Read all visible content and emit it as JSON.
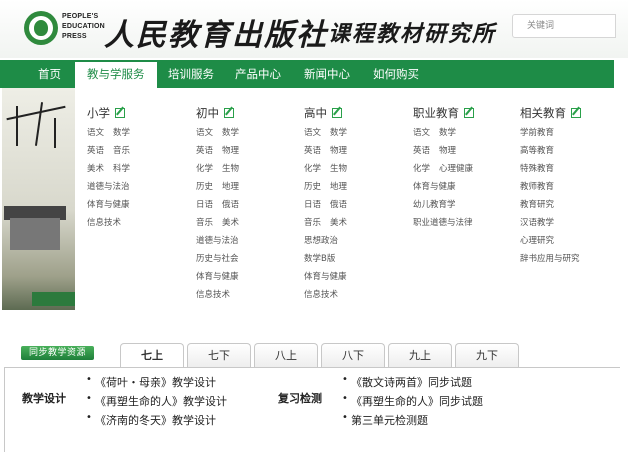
{
  "header": {
    "publisher_lines": [
      "PEOPLE'S",
      "EDUCATION",
      "PRESS"
    ],
    "brand_name": "人民教育出版社",
    "institute_name": "课程教材研究所",
    "search_placeholder": "关键词"
  },
  "nav": {
    "items": [
      {
        "label": "首页"
      },
      {
        "label": "教与学服务",
        "active": true
      },
      {
        "label": "培训服务"
      },
      {
        "label": "产品中心"
      },
      {
        "label": "新闻中心"
      },
      {
        "label": "如何购买"
      }
    ]
  },
  "dropdown": {
    "columns": [
      {
        "title": "小学",
        "rows": [
          [
            "语文",
            "数学"
          ],
          [
            "英语",
            "音乐"
          ],
          [
            "美术",
            "科学"
          ],
          [
            "道德与法治"
          ],
          [
            "体育与健康"
          ],
          [
            "信息技术"
          ]
        ]
      },
      {
        "title": "初中",
        "rows": [
          [
            "语文",
            "数学"
          ],
          [
            "英语",
            "物理"
          ],
          [
            "化学",
            "生物"
          ],
          [
            "历史",
            "地理"
          ],
          [
            "日语",
            "俄语"
          ],
          [
            "音乐",
            "美术"
          ],
          [
            "道德与法治"
          ],
          [
            "历史与社会"
          ],
          [
            "体育与健康"
          ],
          [
            "信息技术"
          ]
        ]
      },
      {
        "title": "高中",
        "rows": [
          [
            "语文",
            "数学"
          ],
          [
            "英语",
            "物理"
          ],
          [
            "化学",
            "生物"
          ],
          [
            "历史",
            "地理"
          ],
          [
            "日语",
            "俄语"
          ],
          [
            "音乐",
            "美术"
          ],
          [
            "思想政治"
          ],
          [
            "数学B版"
          ],
          [
            "体育与健康"
          ],
          [
            "信息技术"
          ]
        ]
      },
      {
        "title": "职业教育",
        "rows": [
          [
            "语文",
            "数学"
          ],
          [
            "英语",
            "物理"
          ],
          [
            "化学",
            "心理健康"
          ],
          [
            "体育与健康"
          ],
          [
            "幼儿教育学"
          ],
          [
            "职业道德与法律"
          ]
        ]
      },
      {
        "title": "相关教育",
        "rows": [
          [
            "学前教育"
          ],
          [
            "高等教育"
          ],
          [
            "特殊教育"
          ],
          [
            "教师教育"
          ],
          [
            "教育研究"
          ],
          [
            "汉语教学"
          ],
          [
            "心理研究"
          ],
          [
            "辞书应用与研究"
          ]
        ]
      }
    ]
  },
  "sync": {
    "label": "同步教学资源",
    "tabs": [
      {
        "label": "七上",
        "active": true
      },
      {
        "label": "七下"
      },
      {
        "label": "八上"
      },
      {
        "label": "八下"
      },
      {
        "label": "九上"
      },
      {
        "label": "九下"
      }
    ],
    "sections": [
      {
        "label": "教学设计",
        "items": [
          "《荷叶・母亲》教学设计",
          "《再塑生命的人》教学设计",
          "《济南的冬天》教学设计"
        ]
      },
      {
        "label": "复习检测",
        "items": [
          "《散文诗两首》同步试题",
          "《再塑生命的人》同步试题",
          "第三单元检测题"
        ]
      }
    ]
  },
  "colors": {
    "brand_green": "#1e8c47",
    "icon_green": "#2aa04a"
  }
}
